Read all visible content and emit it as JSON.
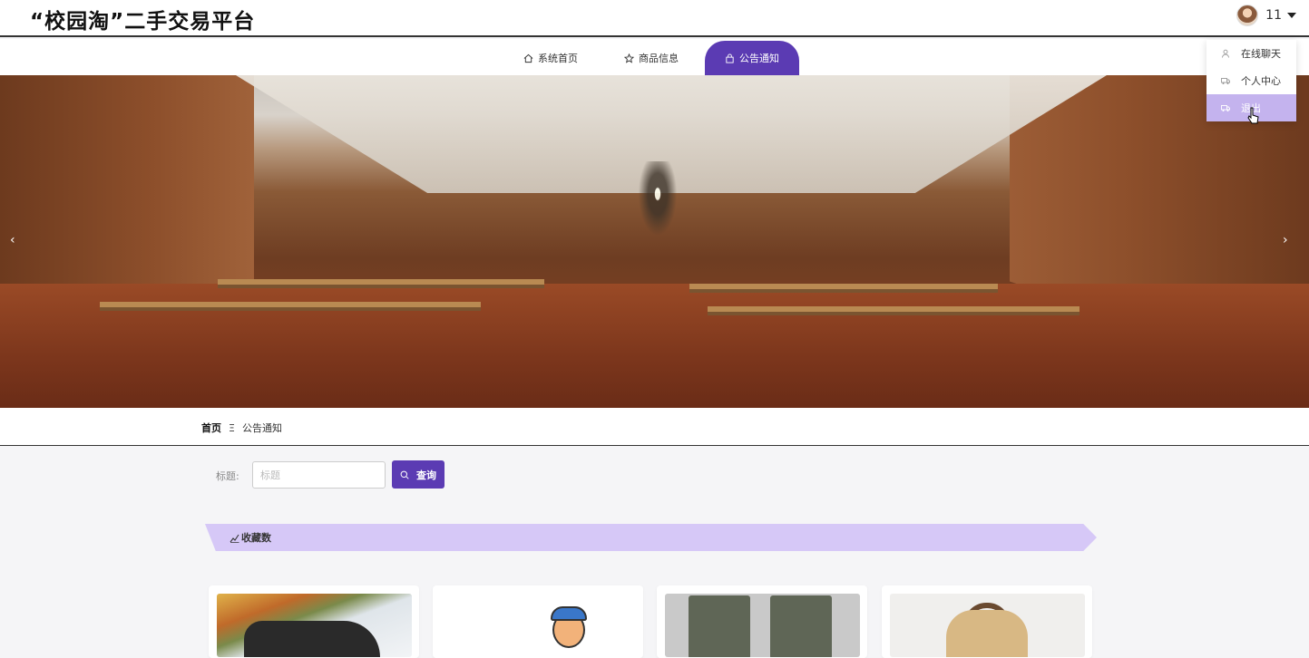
{
  "header": {
    "site_title": "“校园淘”二手交易平台",
    "username": "11"
  },
  "nav": {
    "items": [
      {
        "label": "系统首页",
        "icon": "home-icon"
      },
      {
        "label": "商品信息",
        "icon": "star-icon"
      },
      {
        "label": "公告通知",
        "icon": "bag-icon",
        "active": true
      }
    ]
  },
  "user_menu": {
    "items": [
      {
        "label": "在线聊天",
        "icon": "user-icon"
      },
      {
        "label": "个人中心",
        "icon": "truck-icon"
      },
      {
        "label": "退出",
        "icon": "truck-icon",
        "hovered": true
      }
    ]
  },
  "banner": {
    "prev": "‹",
    "next": "›"
  },
  "breadcrumb": {
    "home": "首页",
    "separator": "Ξ",
    "current": "公告通知"
  },
  "search": {
    "label": "标题:",
    "placeholder": "标题",
    "value": "",
    "button": "查询"
  },
  "sort": {
    "label": "收藏数"
  },
  "colors": {
    "accent": "#5b3bb3",
    "sort_bar": "#d6c8f7",
    "menu_hover": "#c4b3ee"
  }
}
